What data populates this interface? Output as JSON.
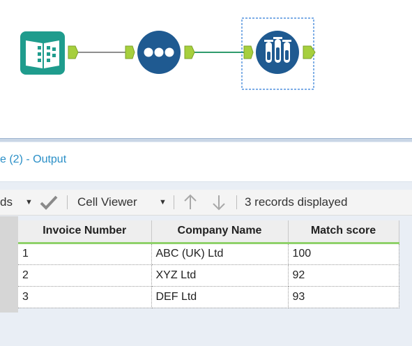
{
  "results": {
    "title": "e (2) - Output"
  },
  "toolbar": {
    "partial_label": "ds",
    "cell_viewer_label": "Cell Viewer",
    "records_status": "3 records displayed"
  },
  "grid": {
    "columns": [
      "Invoice Number",
      "Company Name",
      "Match score"
    ],
    "rows": [
      [
        "1",
        "ABC (UK) Ltd",
        "100"
      ],
      [
        "2",
        "XYZ Ltd",
        "92"
      ],
      [
        "3",
        "DEF Ltd",
        "93"
      ]
    ]
  },
  "workflow": {
    "tools": [
      {
        "icon": "input-data-book-icon"
      },
      {
        "icon": "select-dots-icon"
      },
      {
        "icon": "test-tubes-icon"
      }
    ]
  },
  "colors": {
    "accent_blue": "#1f5a91",
    "input_teal": "#1f9c8d",
    "connector_green": "#a6cf3d",
    "link_blue": "#2a8fc7",
    "header_underline": "#8fd16a"
  }
}
